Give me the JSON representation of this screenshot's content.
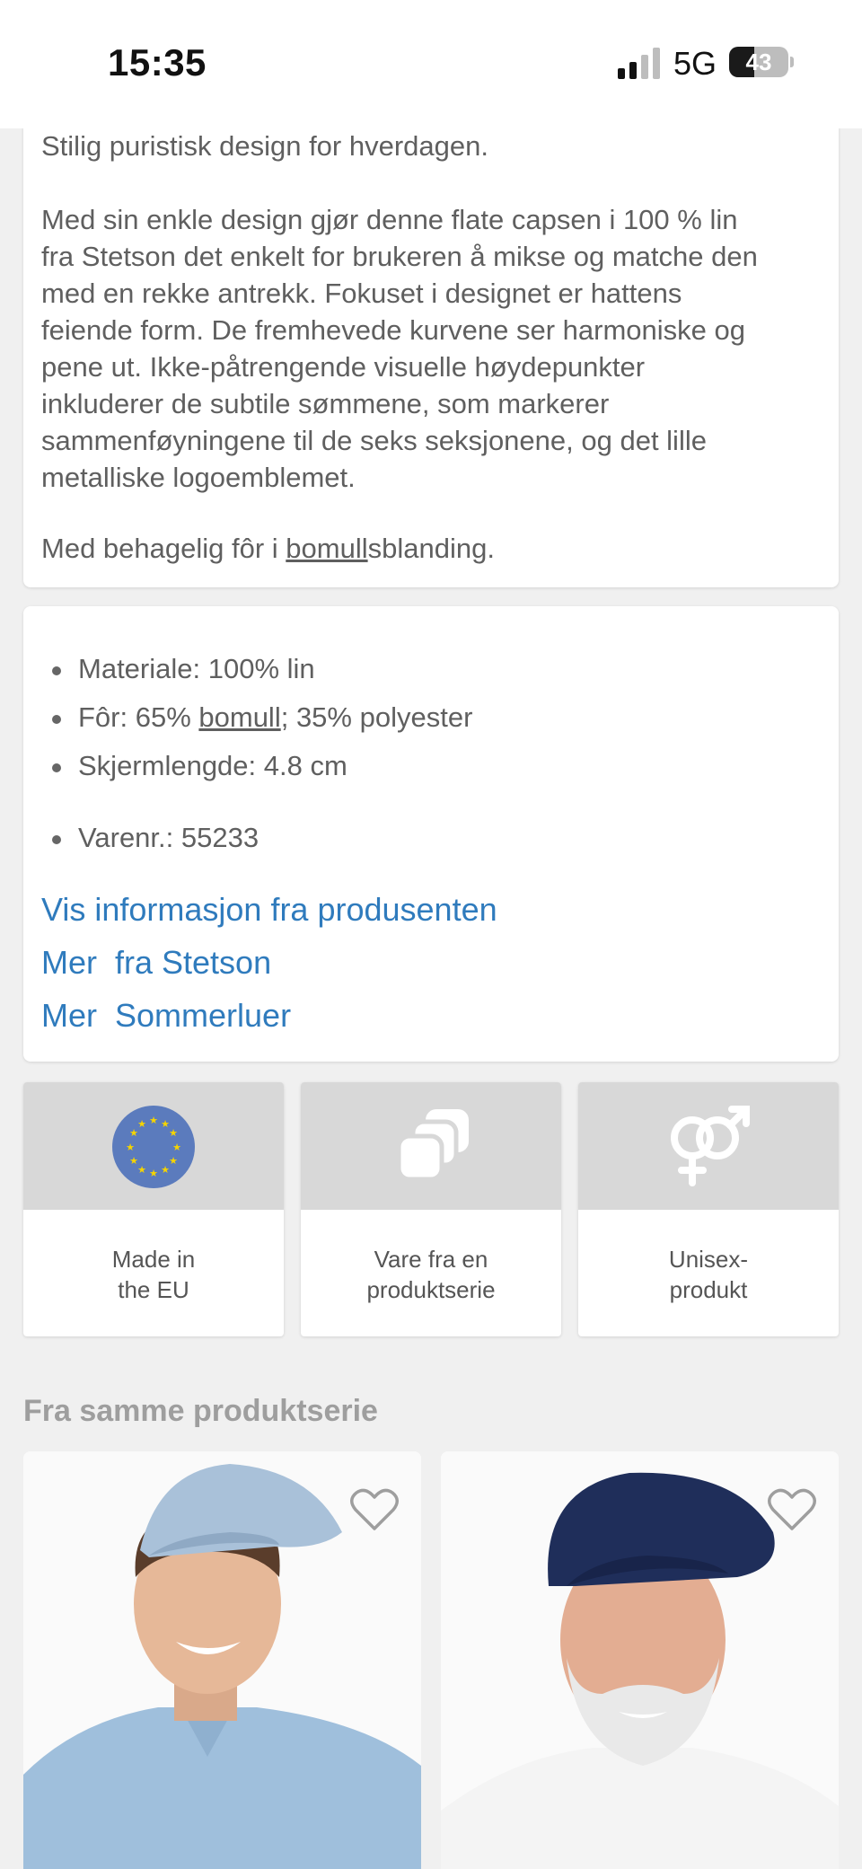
{
  "status_bar": {
    "time": "15:35",
    "network": "5G",
    "battery": "43"
  },
  "description": {
    "intro": "Stilig puristisk design for hverdagen.",
    "lines": [
      "Med sin enkle design gjør denne flate capsen i 100 % lin",
      "fra Stetson det enkelt for brukeren å mikse og matche den",
      "med en rekke antrekk. Fokuset i designet er hattens",
      "feiende form. De fremhevede kurvene ser harmoniske og",
      "pene ut. Ikke-påtrengende visuelle høydepunkter",
      "inkluderer de subtile sømmene, som markerer",
      "sammenføyningene til de seks seksjonene, og det lille",
      "metalliske logoemblemet."
    ],
    "lining_prefix": "Med behagelig fôr i ",
    "lining_link": "bomull",
    "lining_suffix": "sblanding."
  },
  "specs": {
    "material": "Materiale: 100% lin",
    "lining_prefix": "Fôr: 65% ",
    "lining_link": "bomull",
    "lining_suffix": "; 35% polyester",
    "brim": "Skjermlengde: 4.8 cm",
    "item_no": "Varenr.: 55233"
  },
  "links": {
    "manufacturer_info": "Vis informasjon fra produsenten",
    "more_brand": "Mer  fra Stetson",
    "more_category": "Mer  Sommerluer"
  },
  "features": [
    {
      "icon": "eu-flag-icon",
      "line1": "Made in",
      "line2": "the EU"
    },
    {
      "icon": "product-series-icon",
      "line1": "Vare fra en",
      "line2": "produktserie"
    },
    {
      "icon": "unisex-icon",
      "line1": "Unisex-",
      "line2": "produkt"
    }
  ],
  "related": {
    "title": "Fra samme produktserie",
    "products": [
      {
        "image": "man-light-blue-flat-cap"
      },
      {
        "image": "man-navy-newsboy-cap"
      }
    ]
  },
  "colors": {
    "link": "#2f7bbd",
    "eu_blue": "#5b7bbd",
    "eu_star": "#f5d400"
  }
}
